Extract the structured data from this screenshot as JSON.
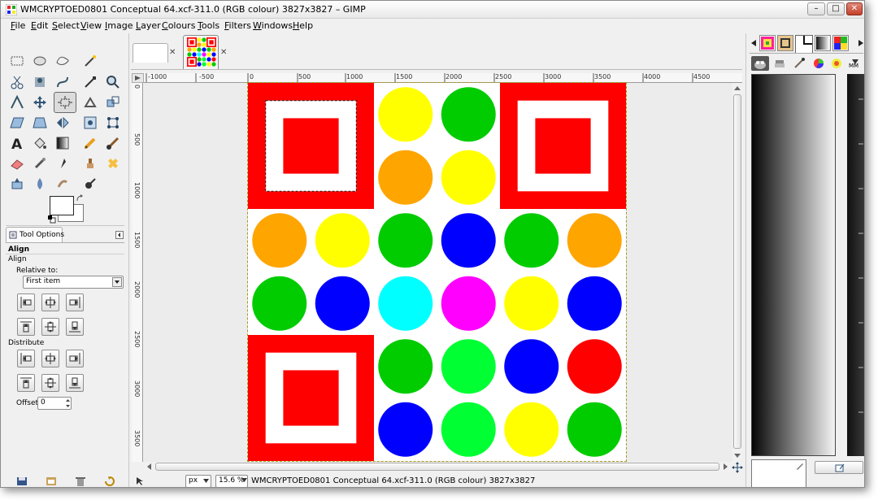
{
  "window": {
    "title": "WMCRYPTOED0801 Conceptual 64.xcf-311.0 (RGB colour) 3827x3827 – GIMP",
    "minimize_label": "–",
    "maximize_label": "□",
    "close_label": "✕"
  },
  "menu": [
    "File",
    "Edit",
    "Select",
    "View",
    "Image",
    "Layer",
    "Colours",
    "Tools",
    "Filters",
    "Windows",
    "Help"
  ],
  "tool_options": {
    "tab_label": "Tool Options",
    "section_title": "Align",
    "subtitle": "Align",
    "relative_to_label": "Relative to:",
    "relative_to_value": "First item",
    "distribute_label": "Distribute",
    "offset_label": "Offset:",
    "offset_value": "0"
  },
  "image_tabs": {
    "close_glyph": "✕"
  },
  "rulers": {
    "horizontal": [
      "-1000",
      "-500",
      "0",
      "500",
      "1000",
      "1500",
      "2000",
      "2500",
      "3000",
      "3500",
      "4000",
      "4500"
    ],
    "vertical": [
      "0",
      "500",
      "1000",
      "1500",
      "2000",
      "2500",
      "3000",
      "3500"
    ]
  },
  "status": {
    "unit": "px",
    "zoom": "15.6 %",
    "text": "WMCRYPTOED0801 Conceptual 64.xcf-311.0 (RGB colour) 3827x3827"
  },
  "image_content": {
    "circles": [
      [
        "",
        "",
        "yellow",
        "green",
        "",
        ""
      ],
      [
        "",
        "",
        "orange",
        "yellow",
        "",
        ""
      ],
      [
        "orange",
        "yellow",
        "green",
        "blue",
        "green",
        "orange"
      ],
      [
        "green",
        "blue",
        "cyan",
        "magenta",
        "yellow",
        "blue"
      ],
      [
        "",
        "",
        "green",
        "lime",
        "blue",
        "red"
      ],
      [
        "",
        "",
        "blue",
        "lime",
        "yellow",
        "green"
      ]
    ],
    "colors": {
      "yellow": "#ffff00",
      "green": "#00cc00",
      "lime": "#00ff33",
      "orange": "#ffa500",
      "blue": "#0000ff",
      "cyan": "#00ffff",
      "magenta": "#ff00ff",
      "red": "#ff0000"
    },
    "frame_color": "#ff0000"
  }
}
